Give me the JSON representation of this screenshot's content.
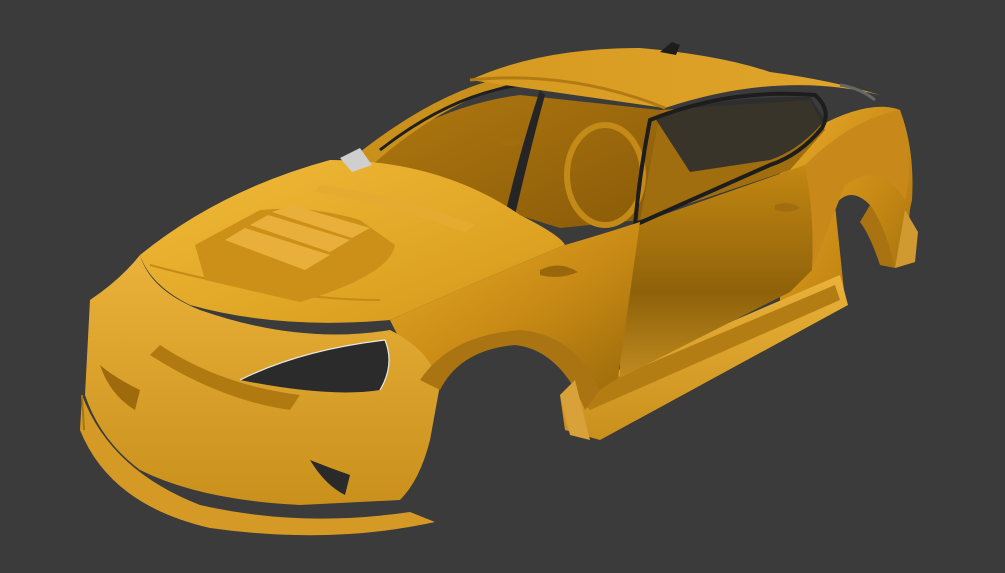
{
  "viewport": {
    "background_color": "#3b3b3b"
  },
  "model": {
    "subject": "car-body-shell",
    "paint_color": "#d89a1c",
    "paint_shadow_color": "#8a5e08",
    "paint_highlight_color": "#f0b83a",
    "glass_color": "#2e2e2e"
  }
}
